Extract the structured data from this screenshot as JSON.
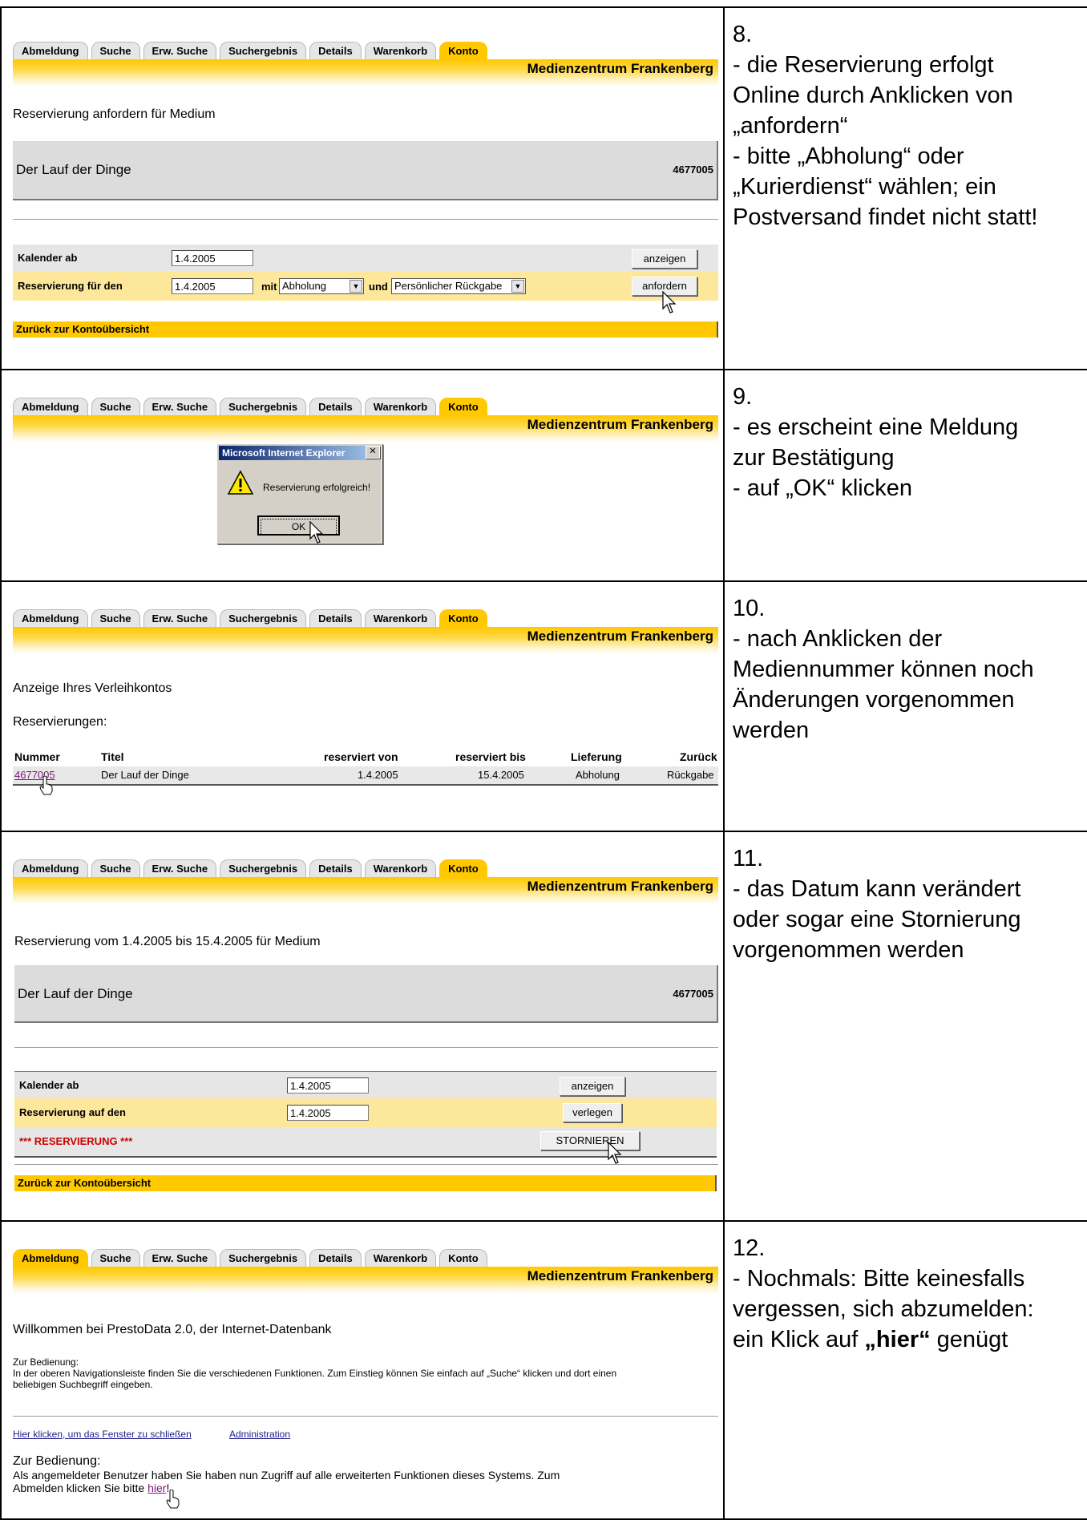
{
  "tabs": [
    "Abmeldung",
    "Suche",
    "Erw. Suche",
    "Suchergebnis",
    "Details",
    "Warenkorb",
    "Konto"
  ],
  "banner_title": "Medienzentrum Frankenberg",
  "steps": [
    {
      "number": "8.",
      "lines": [
        "- die Reservierung erfolgt",
        "Online durch Anklicken von",
        "„anfordern“",
        "- bitte „Abholung“ oder",
        "„Kurierdienst“ wählen; ein",
        "Postversand findet nicht statt!"
      ],
      "screen": {
        "heading": "Reservierung anfordern für Medium",
        "medium_title": "Der Lauf der Dinge",
        "medium_number": "4677005",
        "calendar_label": "Kalender ab",
        "calendar_value": "1.4.2005",
        "show_button": "anzeigen",
        "reserve_label": "Reservierung für den",
        "reserve_value": "1.4.2005",
        "mit_label": "mit",
        "delivery_value": "Abholung",
        "und_label": "und",
        "return_value": "Persönlicher Rückgabe",
        "request_button": "anfordern",
        "back_link": "Zurück zur Kontoübersicht"
      }
    },
    {
      "number": "9.",
      "lines": [
        "- es erscheint eine Meldung",
        "zur Bestätigung",
        "- auf „OK“ klicken"
      ],
      "screen": {
        "dialog_title": "Microsoft Internet Explorer",
        "dialog_message": "Reservierung erfolgreich!",
        "ok_button": "OK"
      }
    },
    {
      "number": "10.",
      "lines": [
        "- nach Anklicken der",
        "Mediennummer können noch",
        "Änderungen vorgenommen",
        "werden"
      ],
      "screen": {
        "heading": "Anzeige Ihres Verleihkontos",
        "subheading": "Reservierungen:",
        "columns": [
          "Nummer",
          "Titel",
          "reserviert von",
          "reserviert bis",
          "Lieferung",
          "Zurück"
        ],
        "row": [
          "4677005",
          "Der Lauf der Dinge",
          "1.4.2005",
          "15.4.2005",
          "Abholung",
          "Rückgabe"
        ]
      }
    },
    {
      "number": "11.",
      "lines": [
        "- das Datum kann verändert",
        "oder sogar eine Stornierung",
        "vorgenommen werden"
      ],
      "screen": {
        "heading": "Reservierung vom 1.4.2005 bis 15.4.2005 für Medium",
        "medium_title": "Der Lauf der Dinge",
        "medium_number": "4677005",
        "calendar_label": "Kalender ab",
        "calendar_value": "1.4.2005",
        "show_button": "anzeigen",
        "reserve_label": "Reservierung auf den",
        "reserve_value": "1.4.2005",
        "move_button": "verlegen",
        "status_label": "*** RESERVIERUNG ***",
        "cancel_button": "STORNIEREN",
        "back_link": "Zurück zur Kontoübersicht"
      }
    },
    {
      "number": "12.",
      "lines": [
        "- Nochmals: Bitte keinesfalls",
        "vergessen, sich abzumelden:"
      ],
      "last_line_pre": "ein Klick auf ",
      "last_line_bold": "„hier“",
      "last_line_post": " genügt",
      "screen": {
        "heading": "Willkommen bei PrestoData 2.0, der Internet-Datenbank",
        "usage_label": "Zur Bedienung:",
        "usage_text_1": "In der oberen Navigationsleiste finden Sie die verschiedenen Funktionen. Zum Einstieg können Sie einfach auf „Suche“ klicken und dort einen",
        "usage_text_2": "beliebigen Suchbegriff eingeben.",
        "close_link": "Hier klicken, um das Fenster zu schließen",
        "admin_link": "Administration",
        "usage_heading": "Zur Bedienung:",
        "logout_text_1": "Als angemeldeter Benutzer haben Sie haben nun Zugriff auf alle erweiterten Funktionen dieses Systems. Zum",
        "logout_text_2": "Abmelden klicken Sie bitte ",
        "logout_link": "hier",
        "logout_text_3": "!"
      }
    }
  ]
}
